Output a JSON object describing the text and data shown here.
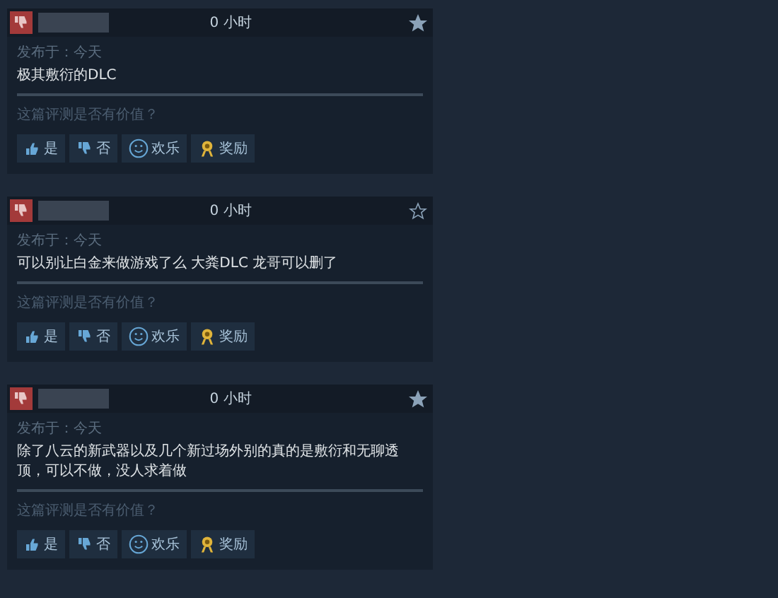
{
  "reviews": [
    {
      "recommended": false,
      "hours": "0 小时",
      "starred": true,
      "posted": "发布于：今天",
      "text": "极其敷衍的DLC",
      "helpful_prompt": "这篇评测是否有价值？",
      "buttons": [
        {
          "kind": "yes",
          "label": "是"
        },
        {
          "kind": "no",
          "label": "否"
        },
        {
          "kind": "funny",
          "label": "欢乐"
        },
        {
          "kind": "award",
          "label": "奖励"
        }
      ]
    },
    {
      "recommended": false,
      "hours": "0 小时",
      "starred": false,
      "posted": "发布于：今天",
      "text": "可以别让白金来做游戏了么 大粪DLC 龙哥可以删了",
      "helpful_prompt": "这篇评测是否有价值？",
      "buttons": [
        {
          "kind": "yes",
          "label": "是"
        },
        {
          "kind": "no",
          "label": "否"
        },
        {
          "kind": "funny",
          "label": "欢乐"
        },
        {
          "kind": "award",
          "label": "奖励"
        }
      ]
    },
    {
      "recommended": false,
      "hours": "0 小时",
      "starred": true,
      "posted": "发布于：今天",
      "text": "除了八云的新武器以及几个新过场外别的真的是敷衍和无聊透顶，可以不做，没人求着做",
      "helpful_prompt": "这篇评测是否有价值？",
      "buttons": [
        {
          "kind": "yes",
          "label": "是"
        },
        {
          "kind": "no",
          "label": "否"
        },
        {
          "kind": "funny",
          "label": "欢乐"
        },
        {
          "kind": "award",
          "label": "奖励"
        }
      ]
    }
  ]
}
